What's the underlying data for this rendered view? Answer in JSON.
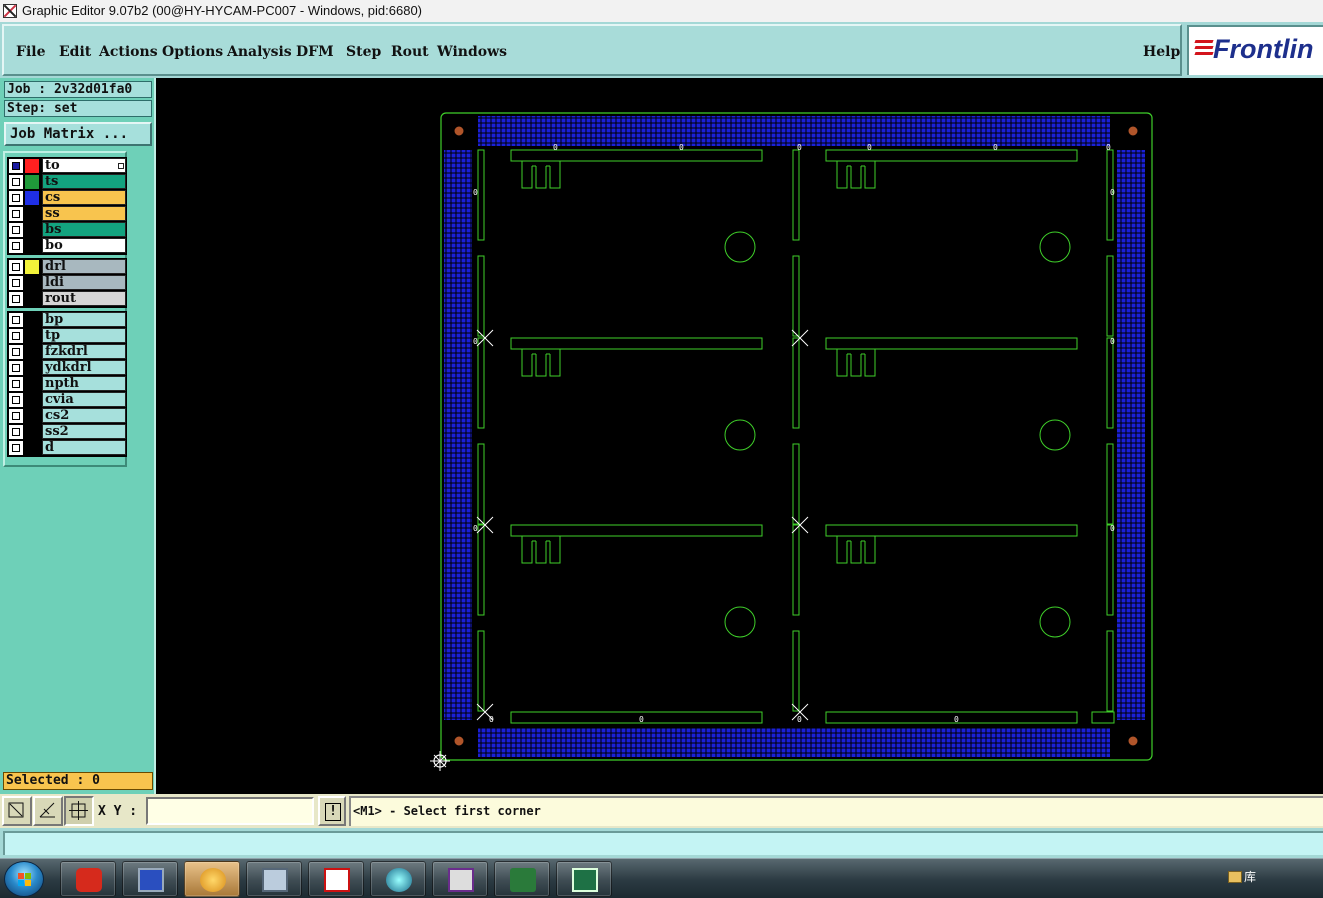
{
  "window": {
    "title": "Graphic Editor 9.07b2 (00@HY-HYCAM-PC007 - Windows, pid:6680)"
  },
  "menu": {
    "items": [
      "File",
      "Edit",
      "Actions",
      "Options",
      "Analysis",
      "DFM",
      "Step",
      "Rout",
      "Windows"
    ],
    "help": "Help",
    "logo": "Frontlin"
  },
  "job": {
    "job_line": "Job : 2v32d01fa0",
    "step_line": "Step: set",
    "matrix_button": "Job Matrix ..."
  },
  "layers": {
    "board": [
      {
        "name": "to",
        "color": "#ff2020",
        "bg": "#ffffff",
        "checked": true
      },
      {
        "name": "ts",
        "color": "#1f9a3a",
        "bg": "#13a37f",
        "checked": false
      },
      {
        "name": "cs",
        "color": "#1f2fe6",
        "bg": "#f8c44e",
        "checked": false
      },
      {
        "name": "ss",
        "color": "#000000",
        "bg": "#f8c44e",
        "checked": false
      },
      {
        "name": "bs",
        "color": "#000000",
        "bg": "#13a37f",
        "checked": false
      },
      {
        "name": "bo",
        "color": "#000000",
        "bg": "#ffffff",
        "checked": false
      }
    ],
    "drill": [
      {
        "name": "drl",
        "color": "#f2f23a",
        "bg": "#a8b8bf",
        "checked": false
      },
      {
        "name": "ldi",
        "color": "#000000",
        "bg": "#a8b8bf",
        "checked": false
      },
      {
        "name": "rout",
        "color": "#000000",
        "bg": "#d6d6d6",
        "checked": false
      }
    ],
    "misc": [
      {
        "name": "bp",
        "color": "#000000",
        "bg": "#a6e0dc",
        "checked": false
      },
      {
        "name": "tp",
        "color": "#000000",
        "bg": "#a6e0dc",
        "checked": false
      },
      {
        "name": "fzkdrl",
        "color": "#000000",
        "bg": "#a6e0dc",
        "checked": false
      },
      {
        "name": "ydkdrl",
        "color": "#000000",
        "bg": "#a6e0dc",
        "checked": false
      },
      {
        "name": "npth",
        "color": "#000000",
        "bg": "#a6e0dc",
        "checked": false
      },
      {
        "name": "cvia",
        "color": "#000000",
        "bg": "#a6e0dc",
        "checked": false
      },
      {
        "name": "cs2",
        "color": "#000000",
        "bg": "#a6e0dc",
        "checked": false
      },
      {
        "name": "ss2",
        "color": "#000000",
        "bg": "#a6e0dc",
        "checked": false
      },
      {
        "name": "d",
        "color": "#000000",
        "bg": "#a6e0dc",
        "checked": false
      }
    ]
  },
  "selected": "Selected : 0",
  "bottom": {
    "xy_label": "X Y :",
    "xy_value": "",
    "bang": "!",
    "prompt": "<M1> - Select first corner"
  },
  "taskbar": {
    "apps": [
      "genesis-icon",
      "save-disk-icon",
      "shell-app-icon",
      "calculator-icon",
      "pdf-reader-icon",
      "viewer-app-icon",
      "graphic-editor-icon",
      "frontline-app-icon",
      "excel-icon"
    ],
    "tray_label": "库"
  },
  "colors": {
    "board_outline": "#3fcf2a",
    "copper_mesh": "#1a20d8",
    "fiducial": "#b0552a",
    "menu_bg": "#a4d8d6",
    "panel_bg": "#6ed0b8"
  }
}
